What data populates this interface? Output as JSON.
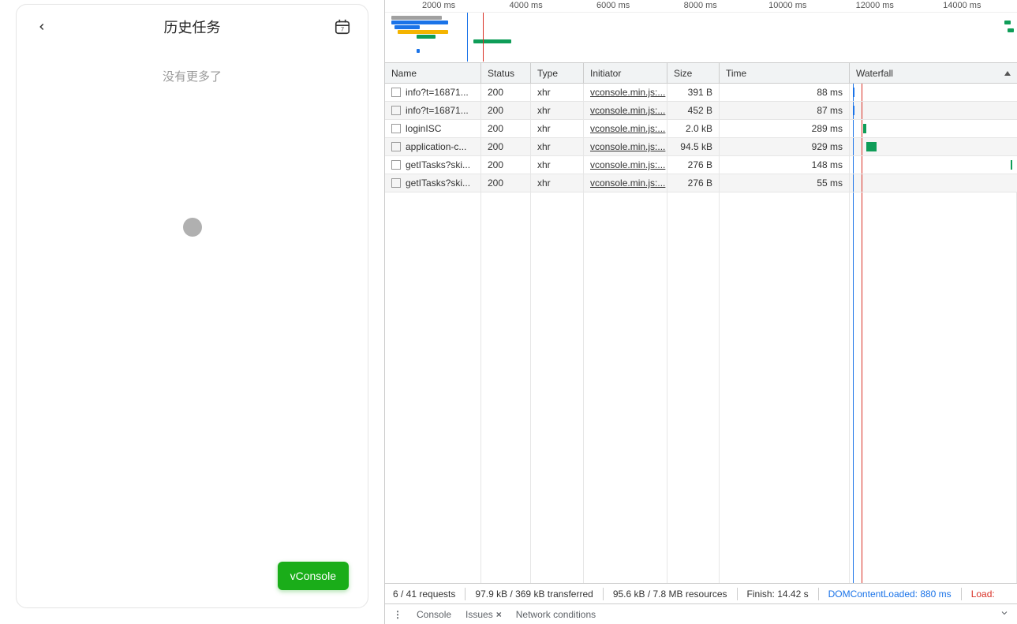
{
  "mobile": {
    "title": "历史任务",
    "empty_text": "没有更多了",
    "vconsole_label": "vConsole"
  },
  "devtools": {
    "overview_ticks": [
      "2000 ms",
      "4000 ms",
      "6000 ms",
      "8000 ms",
      "10000 ms",
      "12000 ms",
      "14000 ms"
    ],
    "columns": {
      "name": "Name",
      "status": "Status",
      "type": "Type",
      "initiator": "Initiator",
      "size": "Size",
      "time": "Time",
      "waterfall": "Waterfall"
    },
    "rows": [
      {
        "name": "info?t=16871...",
        "status": "200",
        "type": "xhr",
        "initiator": "vconsole.min.js:...",
        "size": "391 B",
        "time": "88 ms",
        "wf_left_pct": 2,
        "wf_width_pct": 1,
        "wf_color": "#1a73e8"
      },
      {
        "name": "info?t=16871...",
        "status": "200",
        "type": "xhr",
        "initiator": "vconsole.min.js:...",
        "size": "452 B",
        "time": "87 ms",
        "wf_left_pct": 2,
        "wf_width_pct": 1,
        "wf_color": "#1a73e8"
      },
      {
        "name": "loginISC",
        "status": "200",
        "type": "xhr",
        "initiator": "vconsole.min.js:...",
        "size": "2.0 kB",
        "time": "289 ms",
        "wf_left_pct": 8,
        "wf_width_pct": 2,
        "wf_color": "#0f9d58"
      },
      {
        "name": "application-c...",
        "status": "200",
        "type": "xhr",
        "initiator": "vconsole.min.js:...",
        "size": "94.5 kB",
        "time": "929 ms",
        "wf_left_pct": 10,
        "wf_width_pct": 6,
        "wf_color": "#0f9d58"
      },
      {
        "name": "getITasks?ski...",
        "status": "200",
        "type": "xhr",
        "initiator": "vconsole.min.js:...",
        "size": "276 B",
        "time": "148 ms",
        "wf_left_pct": 96,
        "wf_width_pct": 1,
        "wf_color": "#0f9d58"
      },
      {
        "name": "getITasks?ski...",
        "status": "200",
        "type": "xhr",
        "initiator": "vconsole.min.js:...",
        "size": "276 B",
        "time": "55 ms",
        "wf_left_pct": null,
        "wf_width_pct": null,
        "wf_color": "#0f9d58"
      }
    ],
    "status": {
      "requests": "6 / 41 requests",
      "transferred": "97.9 kB / 369 kB transferred",
      "resources": "95.6 kB / 7.8 MB resources",
      "finish": "Finish: 14.42 s",
      "dcl": "DOMContentLoaded: 880 ms",
      "load": "Load:"
    },
    "drawer": {
      "console": "Console",
      "issues": "Issues",
      "network_conditions": "Network conditions"
    }
  }
}
